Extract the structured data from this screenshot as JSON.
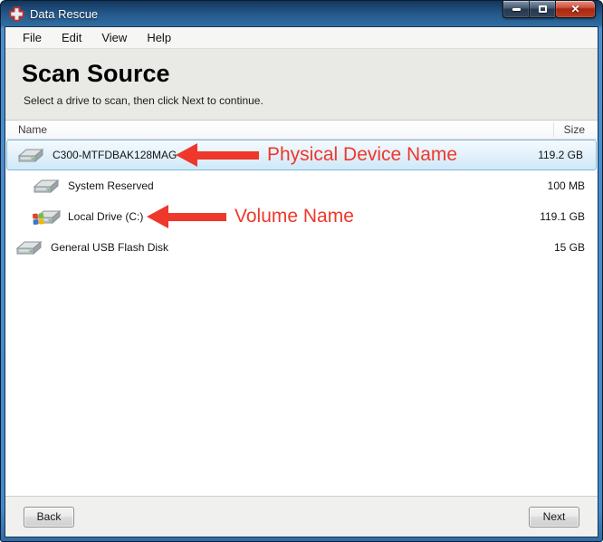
{
  "window": {
    "title": "Data Rescue",
    "app_icon": "red-cross-rescue-icon",
    "controls": [
      {
        "name": "minimize-button"
      },
      {
        "name": "maximize-button"
      },
      {
        "name": "close-button"
      }
    ]
  },
  "menu": {
    "items": [
      "File",
      "Edit",
      "View",
      "Help"
    ]
  },
  "header": {
    "title": "Scan Source",
    "subtitle": "Select a drive to scan, then click Next to continue."
  },
  "table": {
    "columns": {
      "name": "Name",
      "size": "Size"
    },
    "rows": [
      {
        "name": "C300-MTFDBAK128MAG",
        "size": "119.2 GB",
        "selected": true,
        "indent": 0,
        "icon": "hard-drive-icon"
      },
      {
        "name": "System Reserved",
        "size": "100 MB",
        "selected": false,
        "indent": 1,
        "icon": "hard-drive-icon"
      },
      {
        "name": "Local Drive (C:)",
        "size": "119.1 GB",
        "selected": false,
        "indent": 1,
        "icon": "windows-drive-icon"
      },
      {
        "name": "General USB Flash Disk",
        "size": "15 GB",
        "selected": false,
        "indent": 0,
        "icon": "hard-drive-icon"
      }
    ]
  },
  "annotations": [
    {
      "text": "Physical Device Name",
      "target_row": 0
    },
    {
      "text": "Volume Name",
      "target_row": 2
    }
  ],
  "footer": {
    "back_label": "Back",
    "next_label": "Next"
  },
  "colors": {
    "annotation": "#ee382b",
    "selection_border": "#7eb8dd",
    "titlebar_blue": "#2e6ca1",
    "frame_blue": "#4289cc"
  }
}
